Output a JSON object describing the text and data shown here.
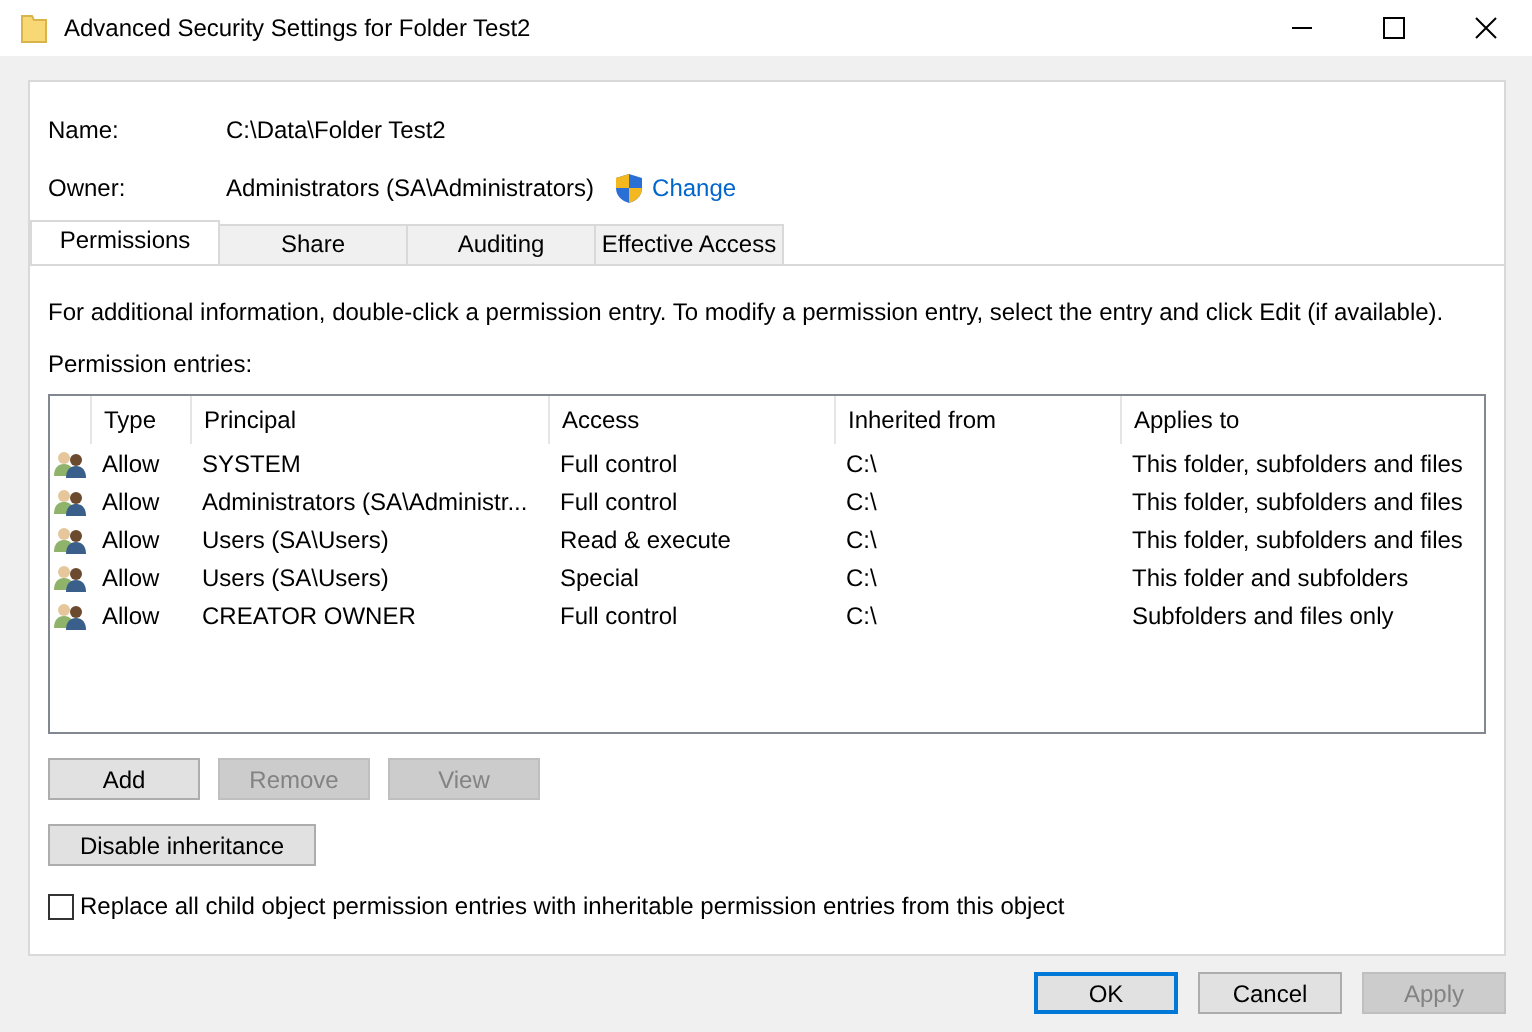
{
  "window": {
    "title": "Advanced Security Settings for Folder Test2"
  },
  "name": {
    "label": "Name:",
    "value": "C:\\Data\\Folder Test2"
  },
  "owner": {
    "label": "Owner:",
    "value": "Administrators (SA\\Administrators)",
    "link": "Change"
  },
  "tabs": [
    {
      "label": "Permissions",
      "selected": true
    },
    {
      "label": "Share",
      "selected": false
    },
    {
      "label": "Auditing",
      "selected": false
    },
    {
      "label": "Effective Access",
      "selected": false
    }
  ],
  "info_text": "For additional information, double-click a permission entry. To modify a permission entry, select the entry and click Edit (if available).",
  "entries_label": "Permission entries:",
  "table": {
    "columns": [
      "Type",
      "Principal",
      "Access",
      "Inherited from",
      "Applies to"
    ],
    "rows": [
      [
        "Allow",
        "SYSTEM",
        "Full control",
        "C:\\",
        "This folder, subfolders and files"
      ],
      [
        "Allow",
        "Administrators (SA\\Administr...",
        "Full control",
        "C:\\",
        "This folder, subfolders and files"
      ],
      [
        "Allow",
        "Users (SA\\Users)",
        "Read & execute",
        "C:\\",
        "This folder, subfolders and files"
      ],
      [
        "Allow",
        "Users (SA\\Users)",
        "Special",
        "C:\\",
        "This folder and subfolders"
      ],
      [
        "Allow",
        "CREATOR OWNER",
        "Full control",
        "C:\\",
        "Subfolders and files only"
      ]
    ]
  },
  "entry_buttons": [
    {
      "label": "Add",
      "disabled": false
    },
    {
      "label": "Remove",
      "disabled": true
    },
    {
      "label": "View",
      "disabled": true
    }
  ],
  "inheritance_button": "Disable inheritance",
  "replace_checkbox": {
    "label": "Replace all child object permission entries with inheritable permission entries from this object",
    "checked": false
  },
  "footer_buttons": [
    {
      "label": "OK",
      "disabled": false,
      "default": true
    },
    {
      "label": "Cancel",
      "disabled": false,
      "default": false
    },
    {
      "label": "Apply",
      "disabled": true,
      "default": false
    }
  ]
}
